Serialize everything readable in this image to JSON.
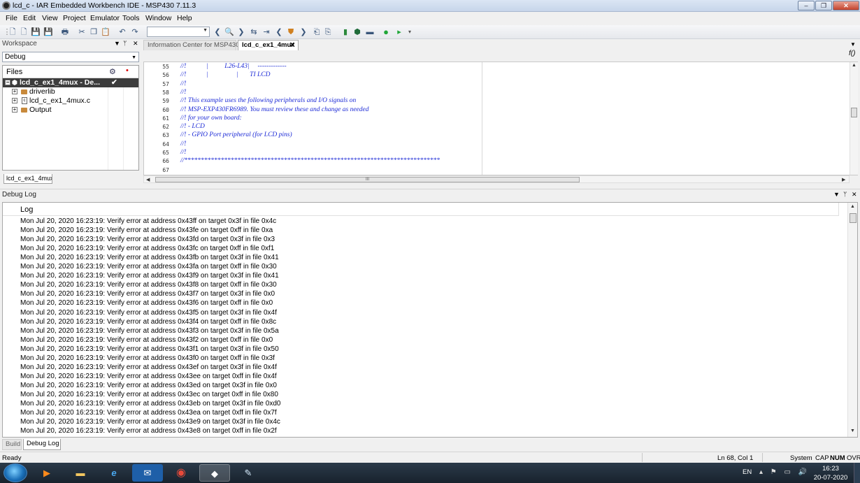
{
  "window": {
    "title": "lcd_c - IAR Embedded Workbench IDE - MSP430 7.11.3",
    "minimize": "‒",
    "restore": "❐",
    "close": "✕"
  },
  "menu": [
    "File",
    "Edit",
    "View",
    "Project",
    "Emulator",
    "Tools",
    "Window",
    "Help"
  ],
  "workspace": {
    "title": "Workspace",
    "configuration": "Debug",
    "files_header": "Files",
    "tree": [
      {
        "label": "lcd_c_ex1_4mux - De...",
        "check": "✔",
        "selected": true
      },
      {
        "label": "driverlib",
        "type": "folder"
      },
      {
        "label": "lcd_c_ex1_4mux.c",
        "type": "c-file"
      },
      {
        "label": "Output",
        "type": "folder"
      }
    ],
    "tab": "lcd_c_ex1_4mux"
  },
  "editor": {
    "tabs": [
      {
        "label": "Information Center for MSP430",
        "active": false
      },
      {
        "label": "lcd_c_ex1_4mux",
        "active": true,
        "close": "✕"
      }
    ],
    "function_glyph": "f()",
    "lines": [
      {
        "num": "55",
        "text": "//!            |          L26-L43|     -------------"
      },
      {
        "num": "56",
        "text": "//!            |                 |       TI LCD"
      },
      {
        "num": "57",
        "text": "//!"
      },
      {
        "num": "58",
        "text": "//!"
      },
      {
        "num": "59",
        "text": "//! This example uses the following peripherals and I/O signals on"
      },
      {
        "num": "60",
        "text": "//! MSP-EXP430FR6989. You must review these and change as needed"
      },
      {
        "num": "61",
        "text": "//! for your own board:"
      },
      {
        "num": "62",
        "text": "//! - LCD"
      },
      {
        "num": "63",
        "text": "//! - GPIO Port peripheral (for LCD pins)"
      },
      {
        "num": "64",
        "text": "//!"
      },
      {
        "num": "65",
        "text": "//!"
      },
      {
        "num": "66",
        "text": "//*****************************************************************************"
      },
      {
        "num": "67",
        "text": ""
      }
    ],
    "hscroll_grip": "III"
  },
  "debug_log": {
    "title": "Debug Log",
    "column": "Log",
    "entries": [
      "Mon Jul 20, 2020 16:23:19: Verify error at address 0x43ff on target 0x3f in file 0x4c",
      "Mon Jul 20, 2020 16:23:19: Verify error at address 0x43fe on target 0xff in file 0xa",
      "Mon Jul 20, 2020 16:23:19: Verify error at address 0x43fd on target 0x3f in file 0x3",
      "Mon Jul 20, 2020 16:23:19: Verify error at address 0x43fc on target 0xff in file 0xf1",
      "Mon Jul 20, 2020 16:23:19: Verify error at address 0x43fb on target 0x3f in file 0x41",
      "Mon Jul 20, 2020 16:23:19: Verify error at address 0x43fa on target 0xff in file 0x30",
      "Mon Jul 20, 2020 16:23:19: Verify error at address 0x43f9 on target 0x3f in file 0x41",
      "Mon Jul 20, 2020 16:23:19: Verify error at address 0x43f8 on target 0xff in file 0x30",
      "Mon Jul 20, 2020 16:23:19: Verify error at address 0x43f7 on target 0x3f in file 0x0",
      "Mon Jul 20, 2020 16:23:19: Verify error at address 0x43f6 on target 0xff in file 0x0",
      "Mon Jul 20, 2020 16:23:19: Verify error at address 0x43f5 on target 0x3f in file 0x4f",
      "Mon Jul 20, 2020 16:23:19: Verify error at address 0x43f4 on target 0xff in file 0x8c",
      "Mon Jul 20, 2020 16:23:19: Verify error at address 0x43f3 on target 0x3f in file 0x5a",
      "Mon Jul 20, 2020 16:23:19: Verify error at address 0x43f2 on target 0xff in file 0x0",
      "Mon Jul 20, 2020 16:23:19: Verify error at address 0x43f1 on target 0x3f in file 0x50",
      "Mon Jul 20, 2020 16:23:19: Verify error at address 0x43f0 on target 0xff in file 0x3f",
      "Mon Jul 20, 2020 16:23:19: Verify error at address 0x43ef on target 0x3f in file 0x4f",
      "Mon Jul 20, 2020 16:23:19: Verify error at address 0x43ee on target 0xff in file 0x4f",
      "Mon Jul 20, 2020 16:23:19: Verify error at address 0x43ed on target 0x3f in file 0x0",
      "Mon Jul 20, 2020 16:23:19: Verify error at address 0x43ec on target 0xff in file 0x80",
      "Mon Jul 20, 2020 16:23:19: Verify error at address 0x43eb on target 0x3f in file 0xd0",
      "Mon Jul 20, 2020 16:23:19: Verify error at address 0x43ea on target 0xff in file 0x7f",
      "Mon Jul 20, 2020 16:23:19: Verify error at address 0x43e9 on target 0x3f in file 0x4c",
      "Mon Jul 20, 2020 16:23:19: Verify error at address 0x43e8 on target 0xff in file 0x2f"
    ]
  },
  "bottom_tabs": [
    {
      "label": "Build",
      "active": false
    },
    {
      "label": "Debug Log",
      "active": true
    }
  ],
  "status": {
    "left": "Ready",
    "position": "Ln 68, Col 1",
    "encoding": "System",
    "cap": "CAP",
    "num": "NUM",
    "ovr": "OVR"
  },
  "taskbar": {
    "apps": [
      "start-orb",
      "media-player",
      "file-explorer",
      "internet-explorer",
      "outlook",
      "chrome",
      "iar-workbench",
      "tool-app"
    ],
    "language": "EN",
    "time": "16:23",
    "date": "20-07-2020"
  },
  "colors": {
    "code_comment": "#1c2ad6",
    "selection": "#3c3c3c",
    "taskbar": "#1f2b38"
  }
}
